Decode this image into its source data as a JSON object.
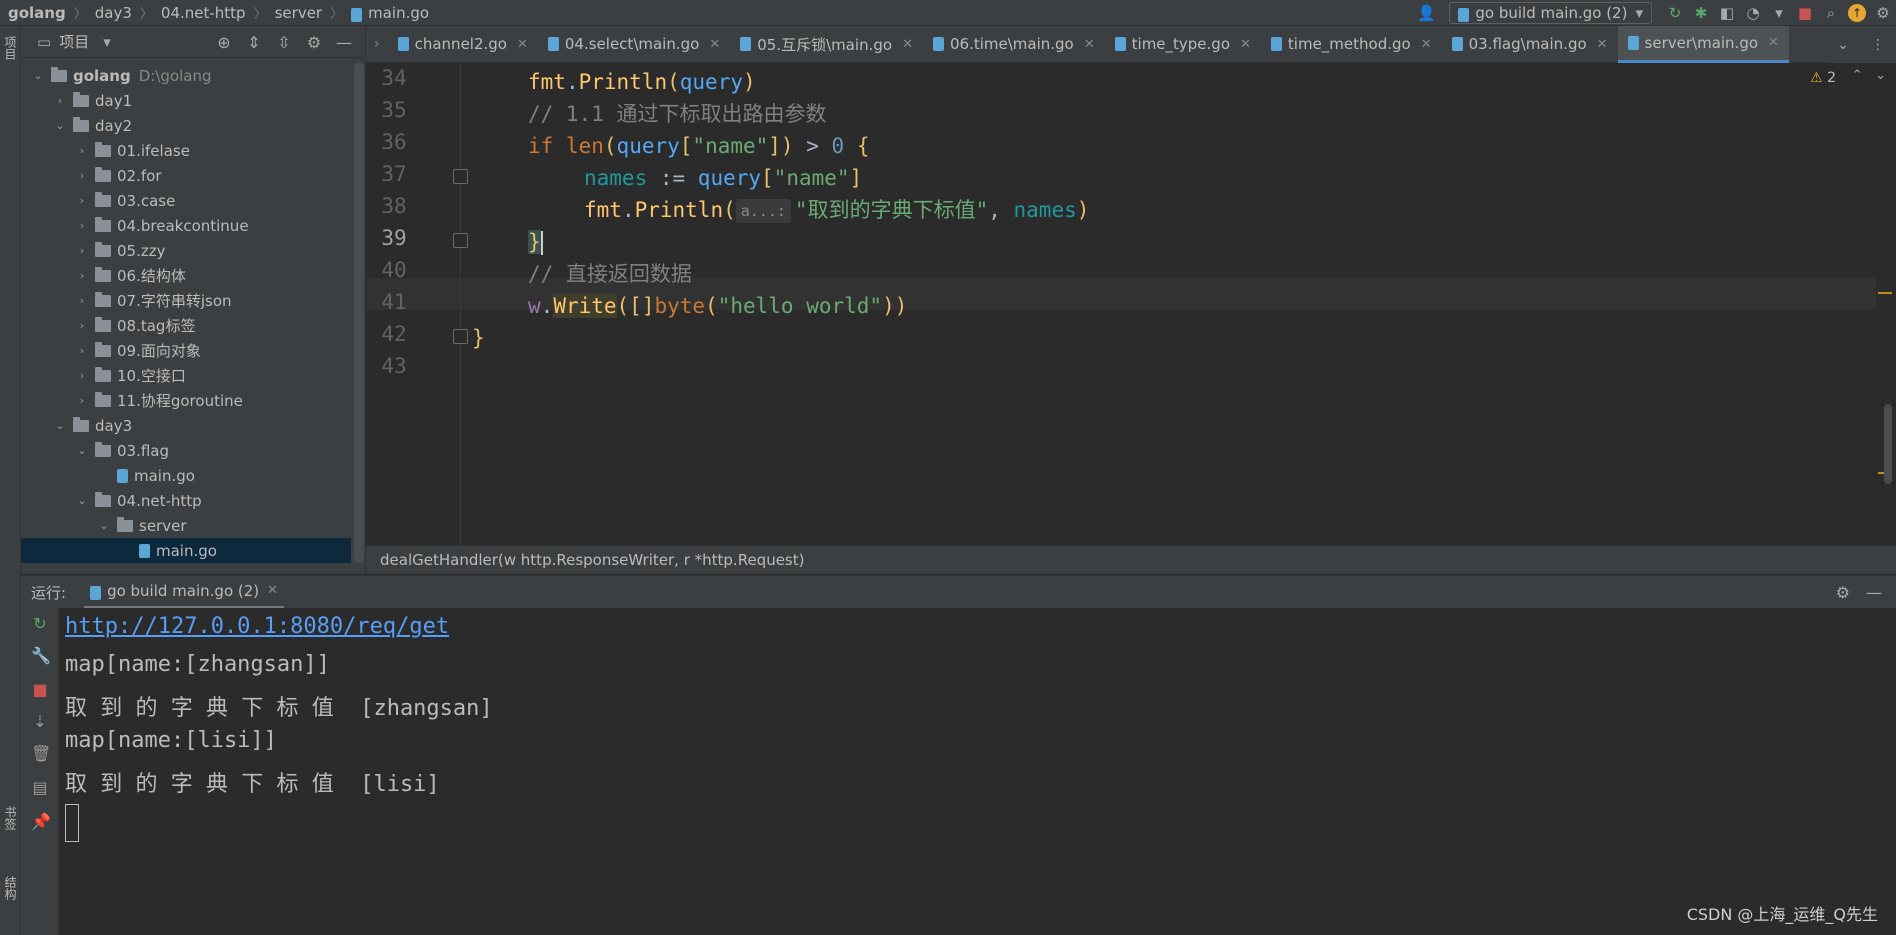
{
  "breadcrumb": [
    "golang",
    "day3",
    "04.net-http",
    "server",
    "main.go"
  ],
  "toolbar": {
    "run_config": "go build main.go (2)"
  },
  "side_tools": {
    "project": "项目",
    "bookmarks": "书签",
    "structure": "结构"
  },
  "project_panel": {
    "title": "项目",
    "tree": [
      {
        "label": "golang",
        "path": "D:\\golang",
        "depth": 0,
        "expanded": true,
        "type": "folder"
      },
      {
        "label": "day1",
        "depth": 1,
        "expanded": false,
        "type": "folder"
      },
      {
        "label": "day2",
        "depth": 1,
        "expanded": true,
        "type": "folder"
      },
      {
        "label": "01.ifelase",
        "depth": 2,
        "expanded": false,
        "type": "folder"
      },
      {
        "label": "02.for",
        "depth": 2,
        "expanded": false,
        "type": "folder"
      },
      {
        "label": "03.case",
        "depth": 2,
        "expanded": false,
        "type": "folder"
      },
      {
        "label": "04.breakcontinue",
        "depth": 2,
        "expanded": false,
        "type": "folder"
      },
      {
        "label": "05.zzy",
        "depth": 2,
        "expanded": false,
        "type": "folder"
      },
      {
        "label": "06.结构体",
        "depth": 2,
        "expanded": false,
        "type": "folder"
      },
      {
        "label": "07.字符串转json",
        "depth": 2,
        "expanded": false,
        "type": "folder"
      },
      {
        "label": "08.tag标签",
        "depth": 2,
        "expanded": false,
        "type": "folder"
      },
      {
        "label": "09.面向对象",
        "depth": 2,
        "expanded": false,
        "type": "folder"
      },
      {
        "label": "10.空接口",
        "depth": 2,
        "expanded": false,
        "type": "folder"
      },
      {
        "label": "11.协程goroutine",
        "depth": 2,
        "expanded": false,
        "type": "folder"
      },
      {
        "label": "day3",
        "depth": 1,
        "expanded": true,
        "type": "folder"
      },
      {
        "label": "03.flag",
        "depth": 2,
        "expanded": true,
        "type": "folder"
      },
      {
        "label": "main.go",
        "depth": 3,
        "type": "file"
      },
      {
        "label": "04.net-http",
        "depth": 2,
        "expanded": true,
        "type": "folder"
      },
      {
        "label": "server",
        "depth": 3,
        "expanded": true,
        "type": "folder"
      },
      {
        "label": "main.go",
        "depth": 4,
        "type": "file",
        "selected": true
      }
    ]
  },
  "tabs": [
    {
      "label": "channel2.go"
    },
    {
      "label": "04.select\\main.go"
    },
    {
      "label": "05.互斥锁\\main.go"
    },
    {
      "label": "06.time\\main.go"
    },
    {
      "label": "time_type.go"
    },
    {
      "label": "time_method.go"
    },
    {
      "label": "03.flag\\main.go"
    },
    {
      "label": "server\\main.go",
      "active": true
    }
  ],
  "editor": {
    "warning_count": "2",
    "line_numbers": [
      "34",
      "35",
      "36",
      "37",
      "38",
      "39",
      "40",
      "41",
      "42",
      "43"
    ],
    "current_line": "39",
    "code": {
      "l34_fmt": "fmt",
      "l34_fn": "Println",
      "l34_arg": "query",
      "l35_comment": "// 1.1 通过下标取出路由参数",
      "l36_kw": "if",
      "l36_len": "len",
      "l36_query": "query",
      "l36_key": "\"name\"",
      "l36_num": "0",
      "l37_names": "names",
      "l37_op": " := ",
      "l37_query": "query",
      "l37_key": "\"name\"",
      "l38_fmt": "fmt",
      "l38_fn": "Println",
      "l38_hint": "a...:",
      "l38_str": "\"取到的字典下标值\"",
      "l38_names": "names",
      "l40_comment": "// 直接返回数据",
      "l41_w": "w",
      "l41_write": "Write",
      "l41_byte": "byte",
      "l41_str": "\"hello world\""
    },
    "breadcrumb": "dealGetHandler(w http.ResponseWriter, r *http.Request)"
  },
  "run_panel": {
    "label": "运行:",
    "tab": "go build main.go (2)",
    "console": [
      {
        "text": "http://127.0.0.1:8080/req/get",
        "link": true
      },
      {
        "text": "map[name:[zhangsan]]"
      },
      {
        "text": "取 到 的 字 典 下 标 值  [zhangsan]"
      },
      {
        "text": "map[name:[lisi]]"
      },
      {
        "text": "取 到 的 字 典 下 标 值  [lisi]"
      }
    ]
  },
  "watermark": "CSDN @上海_运维_Q先生"
}
